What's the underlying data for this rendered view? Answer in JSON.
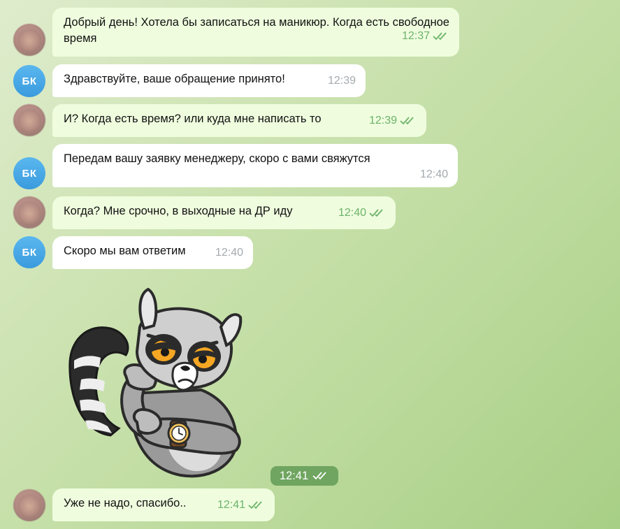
{
  "messages": [
    {
      "sender": "user",
      "text": "Добрый день! Хотела бы записаться на маникюр. Когда есть свободное время",
      "time": "12:37",
      "read": true
    },
    {
      "sender": "bk",
      "avatar": "БК",
      "text": "Здравствуйте, ваше обращение принято!",
      "time": "12:39"
    },
    {
      "sender": "user",
      "text": "И? Когда есть время? или куда мне написать то",
      "time": "12:39",
      "read": true
    },
    {
      "sender": "bk",
      "avatar": "БК",
      "text": "Передам вашу заявку менеджеру, скоро с вами свяжутся",
      "time": "12:40"
    },
    {
      "sender": "user",
      "text": "Когда? Мне срочно, в выходные на ДР иду",
      "time": "12:40",
      "read": true
    },
    {
      "sender": "bk",
      "avatar": "БК",
      "text": "Скоро мы вам ответим",
      "time": "12:40"
    },
    {
      "sender": "user",
      "type": "sticker",
      "sticker": "lemur-watch-sticker",
      "time": "12:41",
      "read": true
    },
    {
      "sender": "user",
      "text": "Уже не надо, спасибо..",
      "time": "12:41",
      "read": true
    }
  ],
  "colors": {
    "outgoing_bubble": "#effdde",
    "incoming_bubble": "#ffffff",
    "read_check": "#6cb36a",
    "avatar_bk": "#3a9bdd"
  }
}
